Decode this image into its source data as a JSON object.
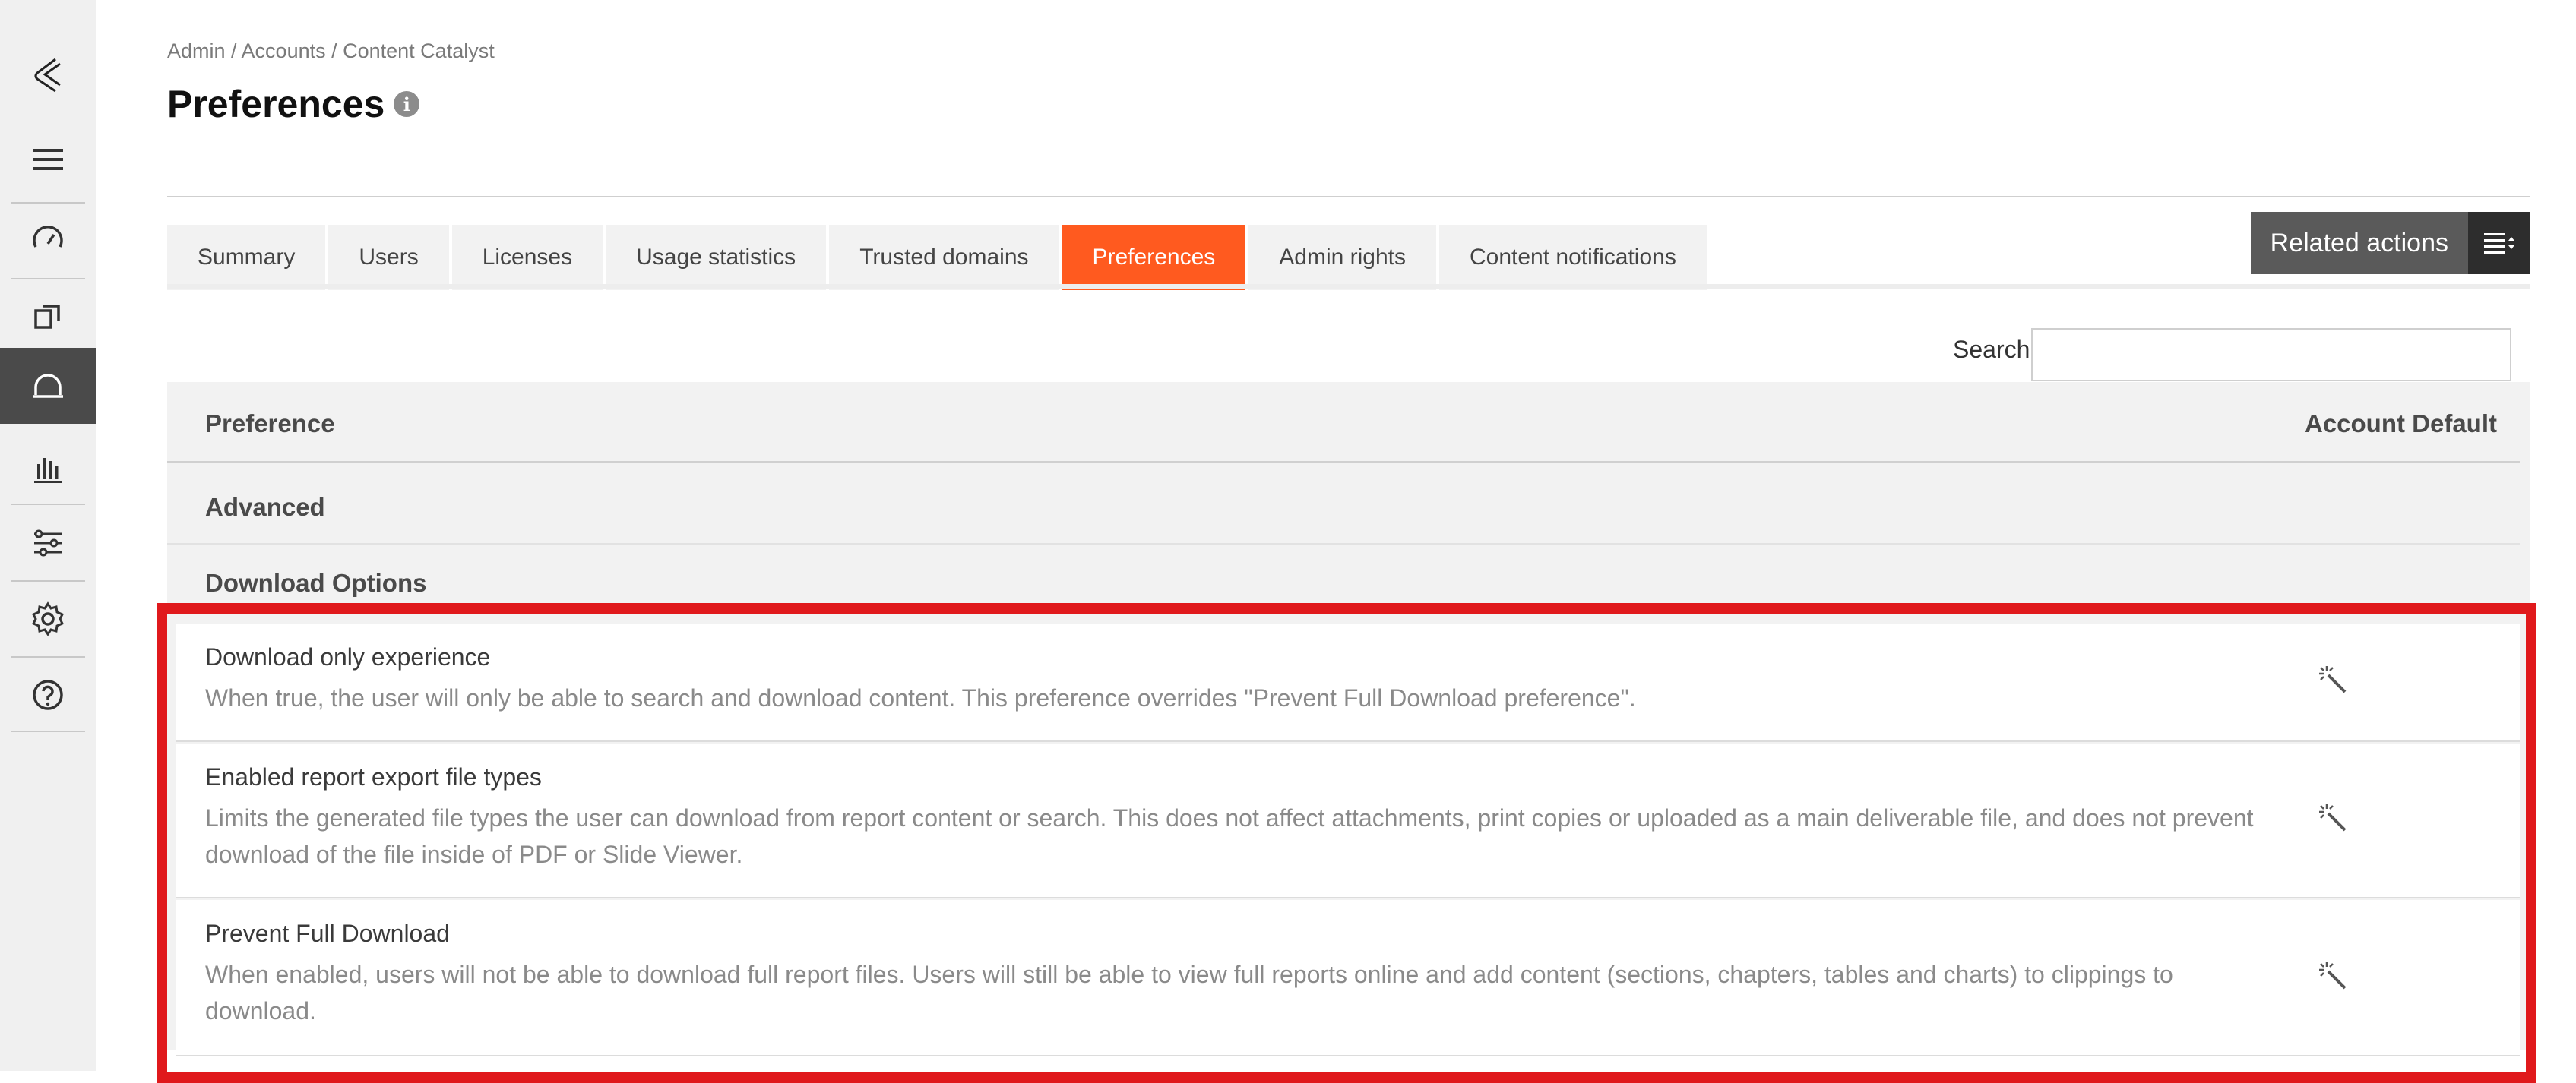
{
  "sidebar": {
    "items": [
      {
        "icon": "logo-icon"
      },
      {
        "icon": "menu-icon"
      },
      {
        "icon": "dashboard-gauge-icon"
      },
      {
        "icon": "copy-windows-icon"
      },
      {
        "icon": "headset-icon",
        "active": true
      },
      {
        "icon": "bar-chart-icon"
      },
      {
        "icon": "sliders-icon"
      },
      {
        "icon": "gear-icon"
      },
      {
        "icon": "help-icon"
      }
    ]
  },
  "header": {
    "breadcrumb": "Admin / Accounts / Content Catalyst",
    "title": "Preferences",
    "info": "i"
  },
  "tabs": [
    {
      "label": "Summary"
    },
    {
      "label": "Users"
    },
    {
      "label": "Licenses"
    },
    {
      "label": "Usage statistics"
    },
    {
      "label": "Trusted domains"
    },
    {
      "label": "Preferences",
      "active": true
    },
    {
      "label": "Admin rights"
    },
    {
      "label": "Content notifications"
    }
  ],
  "related_actions": {
    "label": "Related actions"
  },
  "search": {
    "label": "Search",
    "value": "",
    "placeholder": ""
  },
  "table": {
    "headers": {
      "preference": "Preference",
      "account_default": "Account Default"
    },
    "groups": [
      "Advanced",
      "Download Options"
    ],
    "rows": [
      {
        "title": "Download only experience",
        "description": "When true, the user will only be able to search and download content. This preference overrides \"Prevent Full Download preference\"."
      },
      {
        "title": "Enabled report export file types",
        "description": "Limits the generated file types the user can download from report content or search. This does not affect attachments, print copies or uploaded as a main deliverable file, and does not prevent download of the file inside of PDF or Slide Viewer."
      },
      {
        "title": "Prevent Full Download",
        "description": "When enabled, users will not be able to download full report files. Users will still be able to view full reports online and add content (sections, chapters, tables and charts) to clippings to download."
      }
    ]
  },
  "colors": {
    "accent": "#ff5a1f",
    "highlight": "#e0191c",
    "sidebar_active": "#4a4a4a"
  }
}
